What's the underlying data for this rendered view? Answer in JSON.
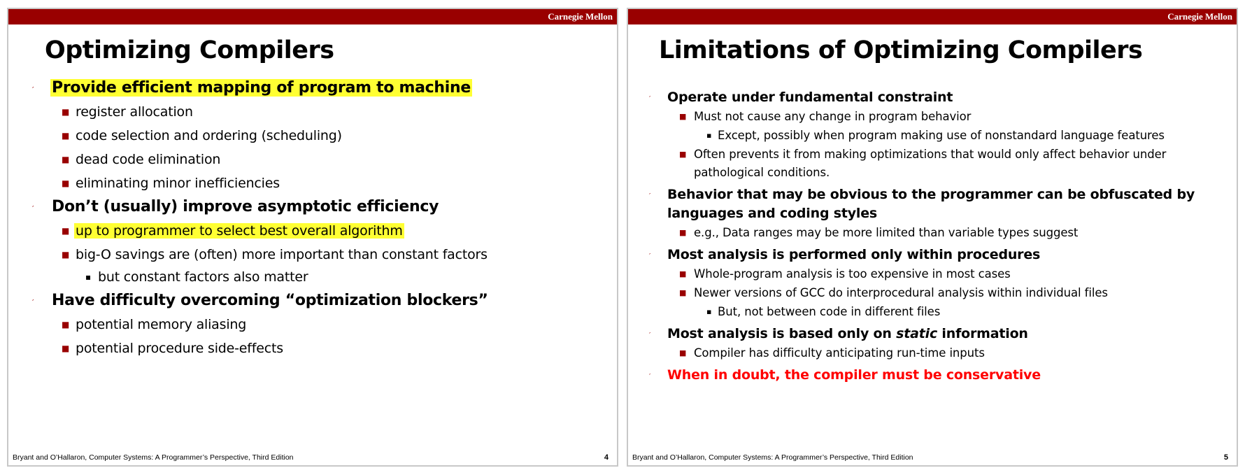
{
  "colors": {
    "brand_bar": "#990000",
    "bullet": "#990000",
    "highlight": "#ffff33",
    "warning_text": "#ff0000",
    "slide_border": "#c8c8c8"
  },
  "slides": [
    {
      "brand": "Carnegie Mellon",
      "title": "Optimizing Compilers",
      "footer": "Bryant and O’Hallaron, Computer Systems: A Programmer’s Perspective, Third Edition",
      "page_number": "4",
      "items": [
        {
          "text": "Provide efficient mapping of program to machine",
          "level": 1,
          "highlight": true
        },
        {
          "text": "register allocation",
          "level": 2
        },
        {
          "text": "code selection and ordering (scheduling)",
          "level": 2
        },
        {
          "text": "dead code elimination",
          "level": 2
        },
        {
          "text": "eliminating minor inefficiencies",
          "level": 2
        },
        {
          "text": "Don’t (usually) improve asymptotic efficiency",
          "level": 1
        },
        {
          "text": "up to programmer to select best overall algorithm",
          "level": 2,
          "highlight": true
        },
        {
          "text": "big-O savings are (often) more important than constant factors",
          "level": 2
        },
        {
          "text": "but constant factors also matter",
          "level": 3
        },
        {
          "text": "Have difficulty overcoming “optimization blockers”",
          "level": 1
        },
        {
          "text": "potential memory aliasing",
          "level": 2
        },
        {
          "text": "potential procedure side-effects",
          "level": 2
        }
      ]
    },
    {
      "brand": "Carnegie Mellon",
      "title": "Limitations of Optimizing Compilers",
      "footer": "Bryant and O’Hallaron, Computer Systems: A Programmer’s Perspective, Third Edition",
      "page_number": "5",
      "items": [
        {
          "text": "Operate under fundamental constraint",
          "level": 1
        },
        {
          "text": "Must not cause any change in program behavior",
          "level": 2
        },
        {
          "text": "Except, possibly when program making use of nonstandard language features",
          "level": 3
        },
        {
          "text": "Often prevents it from making optimizations that would only affect behavior under pathological conditions.",
          "level": 2
        },
        {
          "text": "Behavior that may be obvious to the programmer can  be obfuscated by languages and coding styles",
          "level": 1
        },
        {
          "text": "e.g., Data ranges may be more limited than variable types suggest",
          "level": 2
        },
        {
          "text": "Most analysis is performed only within procedures",
          "level": 1
        },
        {
          "text": "Whole-program analysis is too expensive in most cases",
          "level": 2
        },
        {
          "text": "Newer versions of GCC do interprocedural analysis within individual files",
          "level": 2
        },
        {
          "text": "But, not between code in different files",
          "level": 3
        },
        {
          "text": "Most analysis is based only on ",
          "text_italic": "static",
          "text_after": " information",
          "level": 1
        },
        {
          "text": "Compiler has difficulty anticipating run-time inputs",
          "level": 2
        },
        {
          "text": "When in doubt, the compiler must be conservative",
          "level": 1,
          "red": true
        }
      ]
    }
  ]
}
